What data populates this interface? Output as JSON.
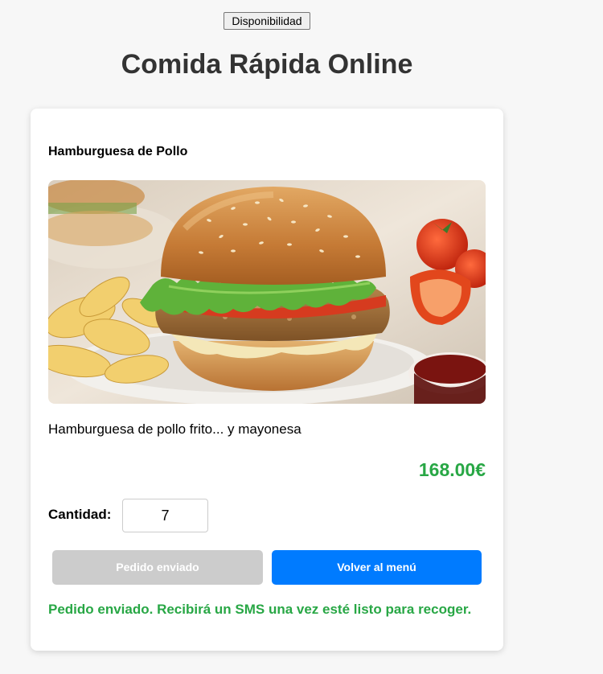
{
  "header": {
    "availability_button": "Disponibilidad",
    "title": "Comida Rápida Online"
  },
  "product": {
    "name": "Hamburguesa de Pollo",
    "image_alt": "Hamburguesa de pollo con papas fritas, tomates y salsa",
    "description": "Hamburguesa de pollo frito... y mayonesa",
    "price": "168.00€"
  },
  "order": {
    "quantity_label": "Cantidad:",
    "quantity_value": "7",
    "sent_button": "Pedido enviado",
    "back_button": "Volver al menú",
    "status_message": "Pedido enviado. Recibirá un SMS una vez esté listo para recoger."
  },
  "colors": {
    "price_green": "#28a745",
    "primary_blue": "#007bff",
    "disabled_gray": "#cccccc",
    "title_text": "#333333"
  }
}
